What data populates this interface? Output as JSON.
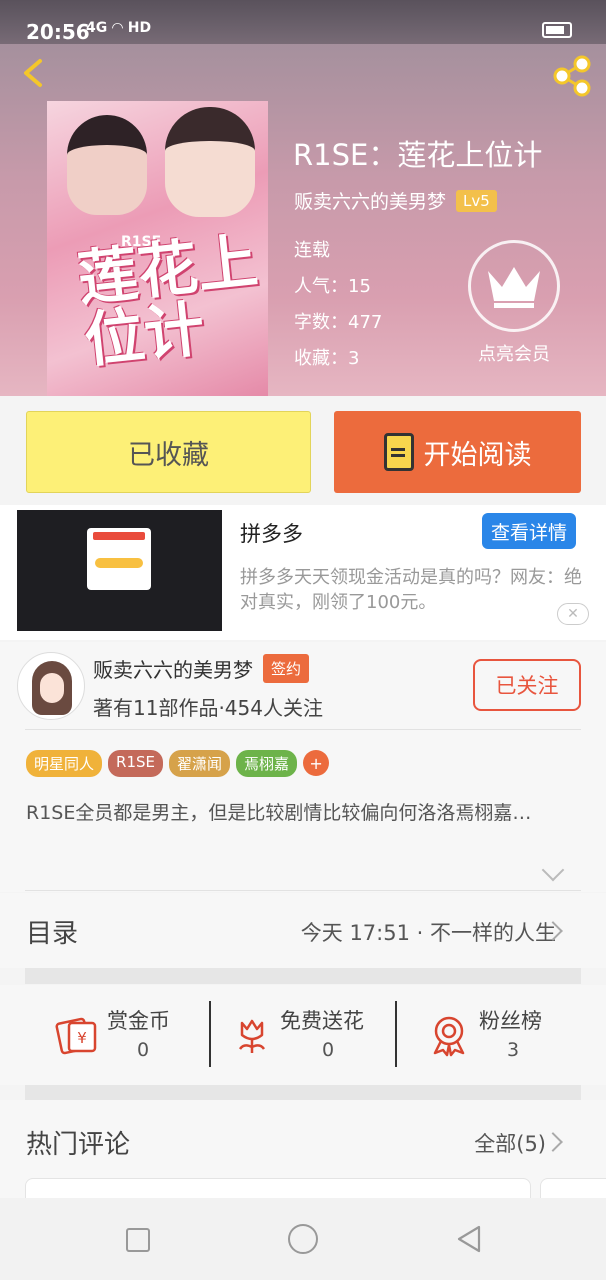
{
  "status_bar": {
    "time": "20:56",
    "signal": "4G",
    "network": "HD"
  },
  "book": {
    "title": "R1SE：莲花上位计",
    "author": "贩卖六六的美男梦",
    "level": "Lv5",
    "status": "连载",
    "popularity": "人气：15",
    "word_count": "字数：477",
    "favorites": "收藏：3",
    "cover_title": "莲花上位计",
    "cover_tag": "R1SE"
  },
  "vip": {
    "label": "点亮会员"
  },
  "actions": {
    "fav_label": "已收藏",
    "read_label": "开始阅读"
  },
  "ad": {
    "name": "拼多多",
    "button": "查看详情",
    "description": "拼多多天天领现金活动是真的吗？网友：绝对真实，刚领了100元。",
    "close": "✕"
  },
  "author_card": {
    "name": "贩卖六六的美男梦",
    "badge": "签约",
    "info": "著有11部作品·454人关注",
    "follow_label": "已关注"
  },
  "tags": [
    {
      "label": "明星同人",
      "color": "#f0b23a"
    },
    {
      "label": "R1SE",
      "color": "#c46a5a"
    },
    {
      "label": "翟潇闻",
      "color": "#d6a24a"
    },
    {
      "label": "焉栩嘉",
      "color": "#6db34a"
    }
  ],
  "tag_more": "+",
  "synopsis": "R1SE全员都是男主，但是比较剧情比较偏向何洛洛焉栩嘉…",
  "toc": {
    "label": "目录",
    "latest": "今天 17:51 · 不一样的人生"
  },
  "stats": [
    {
      "name": "赏金币",
      "count": "0",
      "icon": "coin-envelope-icon"
    },
    {
      "name": "免费送花",
      "count": "0",
      "icon": "flower-icon"
    },
    {
      "name": "粉丝榜",
      "count": "3",
      "icon": "medal-icon"
    }
  ],
  "comments": {
    "title": "热门评论",
    "all_label": "全部(5)"
  },
  "colors": {
    "accent": "#ec6b3d",
    "fav": "#fdf077",
    "ad_button": "#2a86e8",
    "icon_red": "#d8452f"
  }
}
